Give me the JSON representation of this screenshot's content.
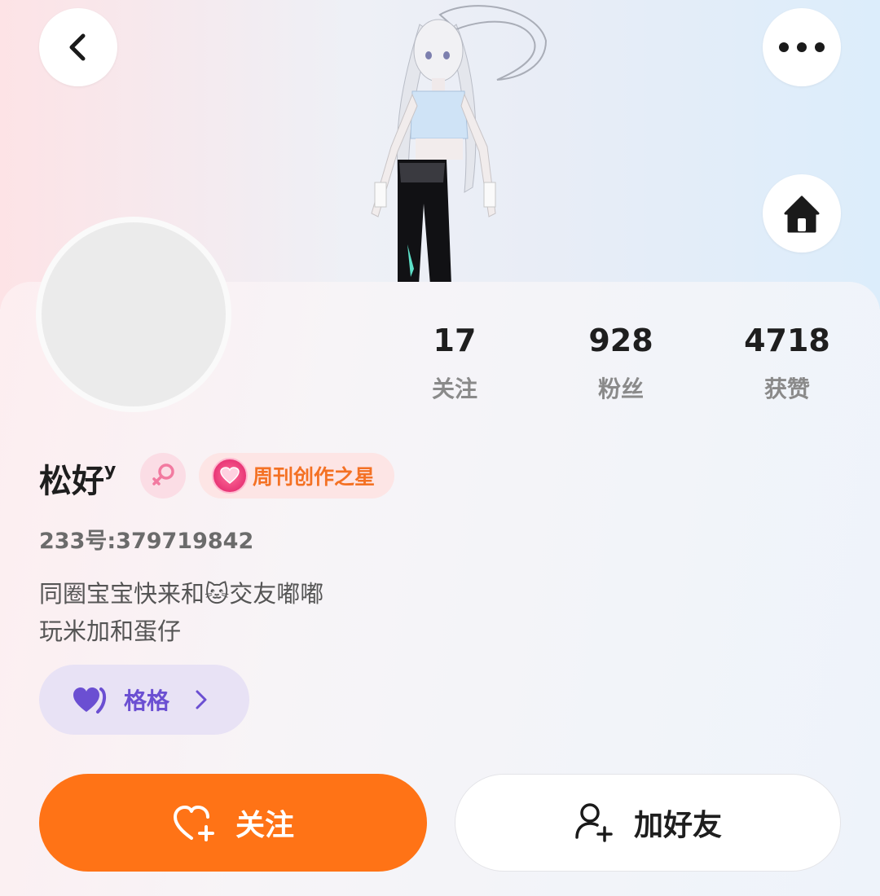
{
  "header": {
    "back_icon": "chevron-left-icon",
    "more_icon": "more-horizontal-icon",
    "home_icon": "home-icon"
  },
  "stats": [
    {
      "value": "17",
      "label": "关注"
    },
    {
      "value": "928",
      "label": "粉丝"
    },
    {
      "value": "4718",
      "label": "获赞"
    }
  ],
  "profile": {
    "name": "松好",
    "name_suffix": "y",
    "gender_icon": "female-symbol-icon",
    "badge": "周刊创作之星",
    "uid": "233号:379719842",
    "bio": "同圈宝宝快来和🐱交友嘟嘟\n玩米加和蛋仔",
    "tag": "格格"
  },
  "actions": {
    "follow": "关注",
    "add_friend": "加好友"
  },
  "colors": {
    "accent_orange": "#ff7316",
    "tag_purple": "#6b4fd2",
    "badge_pink": "#e83676"
  }
}
